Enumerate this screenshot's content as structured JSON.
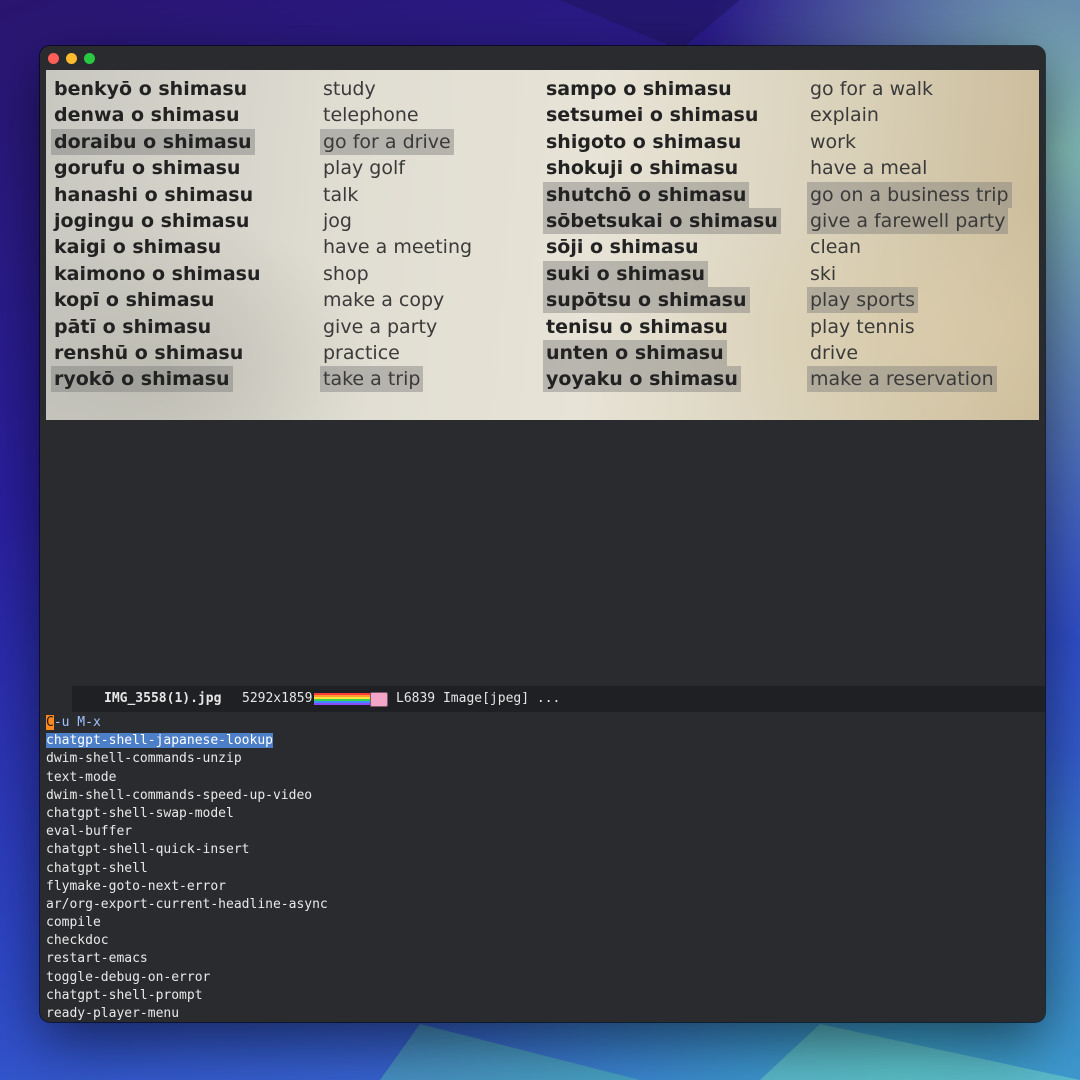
{
  "window": {
    "traffic_lights": [
      "close",
      "minimize",
      "zoom"
    ]
  },
  "image": {
    "columns": [
      {
        "style": "bold",
        "items": [
          {
            "text": "benkyō o shimasu",
            "hl": false
          },
          {
            "text": "denwa o shimasu",
            "hl": false
          },
          {
            "text": "doraibu o shimasu",
            "hl": true
          },
          {
            "text": "gorufu o shimasu",
            "hl": false
          },
          {
            "text": "hanashi o shimasu",
            "hl": false
          },
          {
            "text": "jogingu o shimasu",
            "hl": false
          },
          {
            "text": "kaigi o shimasu",
            "hl": false
          },
          {
            "text": "kaimono o shimasu",
            "hl": false
          },
          {
            "text": "kopī o shimasu",
            "hl": false
          },
          {
            "text": "pātī o shimasu",
            "hl": false
          },
          {
            "text": "renshū o shimasu",
            "hl": false
          },
          {
            "text": "ryokō o shimasu",
            "hl": true
          }
        ]
      },
      {
        "style": "light",
        "items": [
          {
            "text": "study",
            "hl": false
          },
          {
            "text": "telephone",
            "hl": false
          },
          {
            "text": "go for a drive",
            "hl": true
          },
          {
            "text": "play golf",
            "hl": false
          },
          {
            "text": "talk",
            "hl": false
          },
          {
            "text": "jog",
            "hl": false
          },
          {
            "text": "have a meeting",
            "hl": false
          },
          {
            "text": "shop",
            "hl": false
          },
          {
            "text": "make a copy",
            "hl": false
          },
          {
            "text": "give a party",
            "hl": false
          },
          {
            "text": "practice",
            "hl": false
          },
          {
            "text": "take a trip",
            "hl": true
          }
        ]
      },
      {
        "style": "bold",
        "items": [
          {
            "text": "sampo o shimasu",
            "hl": false
          },
          {
            "text": "setsumei o shimasu",
            "hl": false
          },
          {
            "text": "shigoto o shimasu",
            "hl": false
          },
          {
            "text": "shokuji o shimasu",
            "hl": false
          },
          {
            "text": "shutchō o shimasu",
            "hl": true
          },
          {
            "text": "sōbetsukai o shimasu",
            "hl": true
          },
          {
            "text": "sōji o shimasu",
            "hl": false
          },
          {
            "text": "suki o shimasu",
            "hl": true
          },
          {
            "text": "supōtsu o shimasu",
            "hl": true
          },
          {
            "text": "tenisu o shimasu",
            "hl": false
          },
          {
            "text": "unten o shimasu",
            "hl": true
          },
          {
            "text": "yoyaku o shimasu",
            "hl": true
          }
        ]
      },
      {
        "style": "light",
        "items": [
          {
            "text": "go for a walk",
            "hl": false
          },
          {
            "text": "explain",
            "hl": false
          },
          {
            "text": "work",
            "hl": false
          },
          {
            "text": "have a meal",
            "hl": false
          },
          {
            "text": "go on a business trip",
            "hl": true
          },
          {
            "text": "give a farewell party",
            "hl": true
          },
          {
            "text": "clean",
            "hl": false
          },
          {
            "text": "ski",
            "hl": false
          },
          {
            "text": "play sports",
            "hl": true
          },
          {
            "text": "play tennis",
            "hl": false
          },
          {
            "text": "drive",
            "hl": false
          },
          {
            "text": "make a reservation",
            "hl": true
          }
        ]
      }
    ]
  },
  "modeline": {
    "filename": "IMG_3558(1).jpg",
    "dimensions": "5292x1859",
    "status": "L6839 Image[jpeg] ..."
  },
  "minibuffer": {
    "prompt_cursor": "C",
    "prompt_rest": "-u M-x",
    "candidates": [
      "chatgpt-shell-japanese-lookup",
      "dwim-shell-commands-unzip",
      "text-mode",
      "dwim-shell-commands-speed-up-video",
      "chatgpt-shell-swap-model",
      "eval-buffer",
      "chatgpt-shell-quick-insert",
      "chatgpt-shell",
      "flymake-goto-next-error",
      "ar/org-export-current-headline-async",
      "compile",
      "checkdoc",
      "restart-emacs",
      "toggle-debug-on-error",
      "chatgpt-shell-prompt",
      "ready-player-menu"
    ],
    "selected_index": 0
  },
  "colors": {
    "selection": "#4d7fc8",
    "cursor": "#ff8a1e",
    "prompt_keys": "#9fc4ff"
  }
}
